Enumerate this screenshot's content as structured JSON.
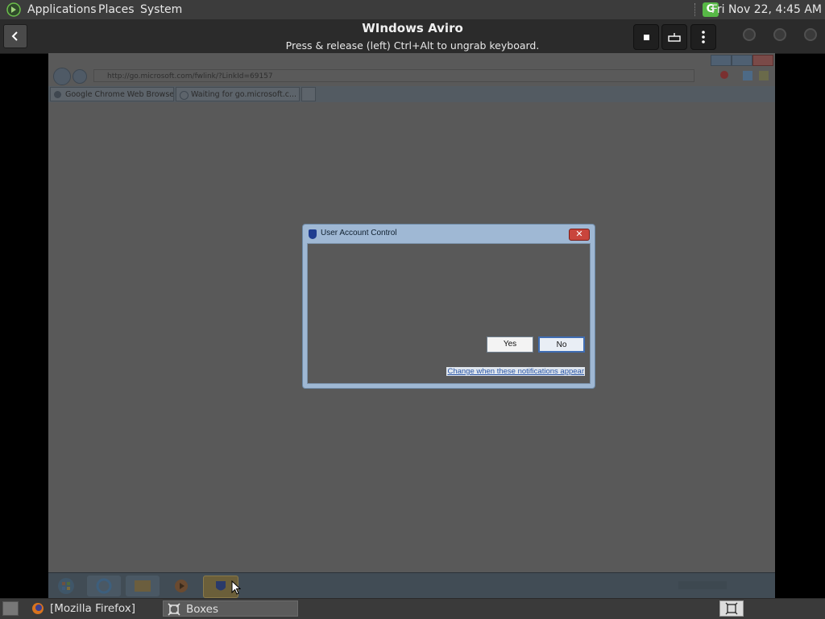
{
  "topbar": {
    "menus": [
      "Applications",
      "Places",
      "System"
    ],
    "clock": "Fri Nov 22,  4:45 AM",
    "tray_badge": "G"
  },
  "boxes": {
    "title": "WIndows Aviro",
    "subtitle": "Press & release (left) Ctrl+Alt to ungrab keyboard."
  },
  "guest": {
    "tabs": [
      "Google Chrome Web Browser",
      "Waiting for go.microsoft.c..."
    ],
    "address": "http://go.microsoft.com/fwlink/?LinkId=69157",
    "uac": {
      "title": "User Account Control",
      "yes_label": "Yes",
      "no_label": "No",
      "link": "Change when these notifications appear"
    }
  },
  "bottom_panel": {
    "tasks": [
      "[Mozilla Firefox]",
      "Boxes"
    ]
  }
}
